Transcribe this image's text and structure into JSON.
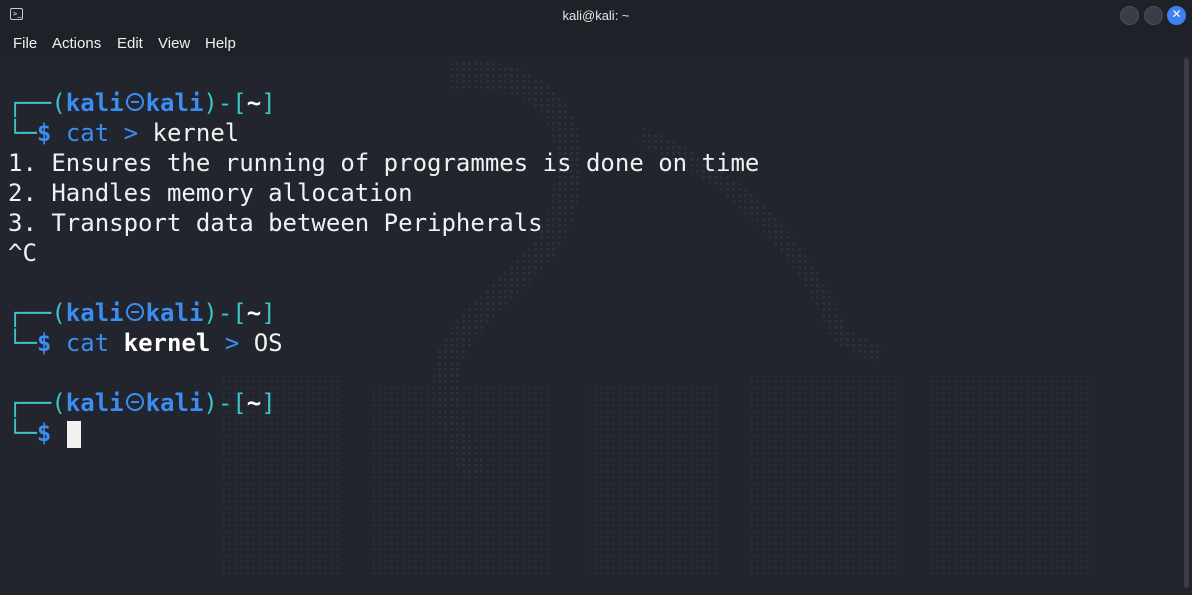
{
  "window": {
    "title": "kali@kali: ~"
  },
  "menu": {
    "items": [
      "File",
      "Actions",
      "Edit",
      "View",
      "Help"
    ]
  },
  "prompt": {
    "user": "kali",
    "host": "kali",
    "dir": "~",
    "symbol": "$"
  },
  "session": {
    "cmd1": {
      "command": "cat",
      "redirect": ">",
      "target": "kernel"
    },
    "output": [
      "1. Ensures the running of programmes is done on time",
      "2. Handles memory allocation",
      "3. Transport data between Peripherals",
      "^C"
    ],
    "cmd2": {
      "command": "cat",
      "source": "kernel",
      "redirect": ">",
      "target": "OS"
    }
  },
  "colors": {
    "bg": "#23252e",
    "teal": "#3cc3c9",
    "blue": "#3b8ef0",
    "close": "#3f7ff2"
  }
}
